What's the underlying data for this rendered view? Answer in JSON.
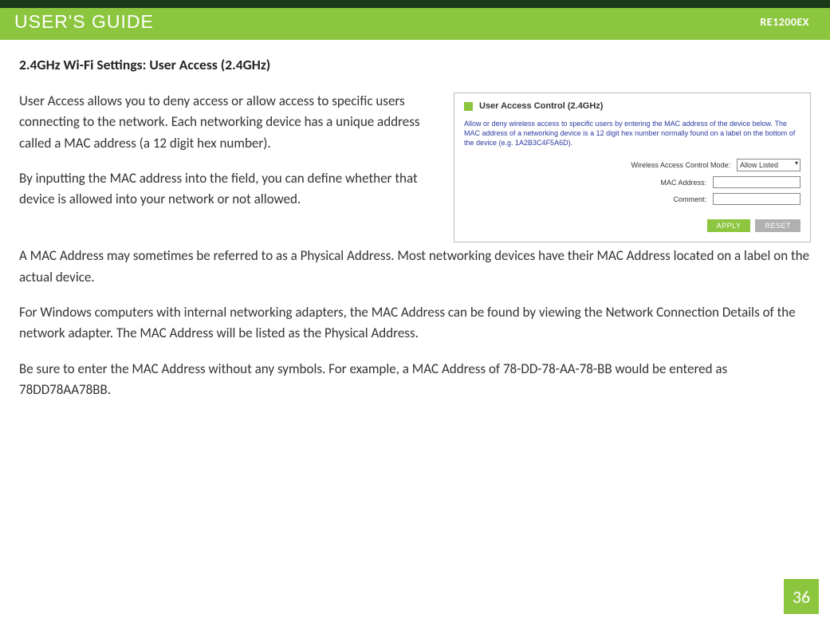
{
  "header": {
    "title_left": "USER'S GUIDE",
    "title_right": "RE1200EX"
  },
  "section": {
    "title": "2.4GHz Wi-Fi Settings: User Access (2.4GHz)"
  },
  "paragraphs": {
    "p1": "User Access allows you to deny access or allow access to specific users connecting to the network. Each networking device has a unique address called a MAC address (a 12 digit hex number).",
    "p2": "By inputting the MAC address into the field, you can define whether that device is allowed into your network or not allowed.",
    "p3": "A MAC Address may sometimes be referred to as a Physical Address. Most networking devices have their MAC Address located on a label on the actual device.",
    "p4": "For Windows computers with internal networking adapters, the MAC Address can be found by viewing the Network Connection Details of the network adapter. The MAC Address will be listed as the Physical Address.",
    "p5": "Be sure to enter the MAC Address without any symbols. For example, a MAC Address of 78-DD-78-AA-78-BB would be entered as 78DD78AA78BB."
  },
  "panel": {
    "title": "User Access Control (2.4GHz)",
    "description": "Allow or deny wireless access to specific users by entering the MAC address of the device below. The MAC address of a networking device is a 12 digit hex number normally found on a label on the bottom of the device (e.g. 1A2B3C4F5A6D).",
    "labels": {
      "mode": "Wireless Access Control Mode:",
      "mac": "MAC Address:",
      "comment": "Comment:"
    },
    "mode_value": "Allow Listed",
    "mac_value": "",
    "comment_value": "",
    "buttons": {
      "apply": "APPLY",
      "reset": "RESET"
    }
  },
  "page_number": "36"
}
